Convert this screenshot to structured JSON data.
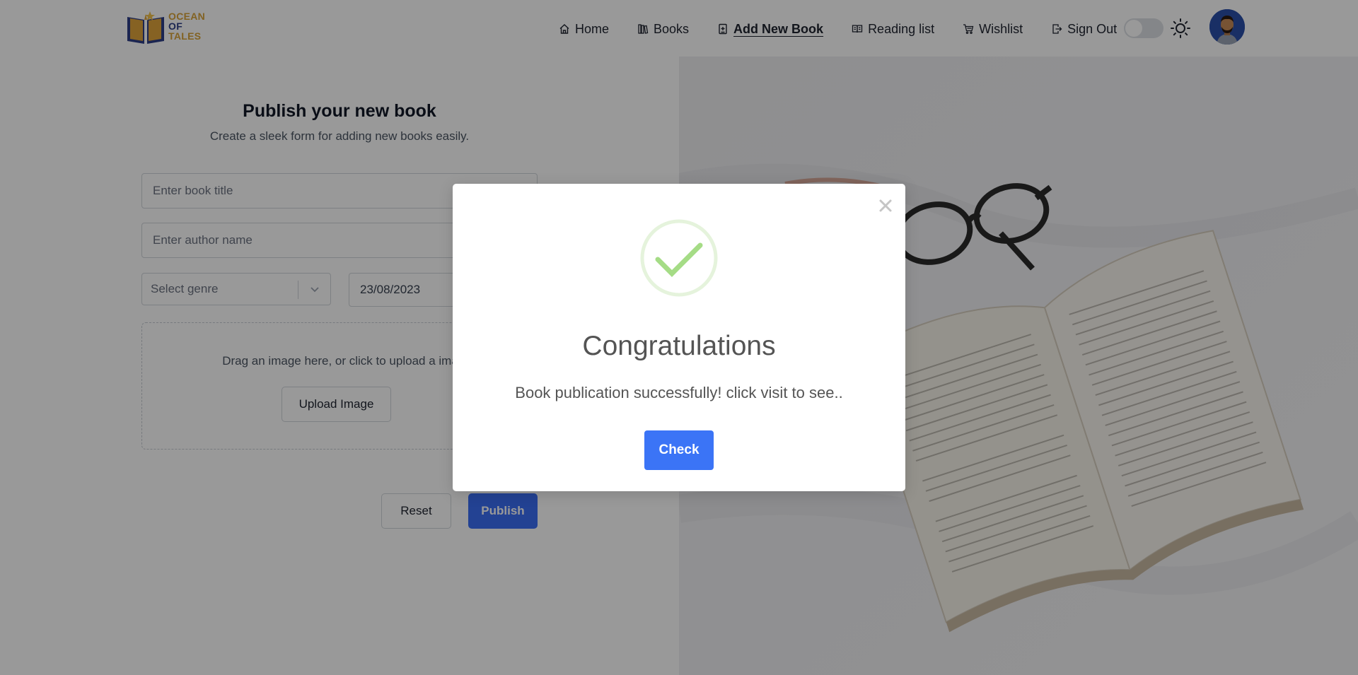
{
  "header": {
    "logo_lines": [
      "OCEAN",
      "OF",
      "TALES"
    ],
    "nav": [
      {
        "label": "Home",
        "icon": "home-icon"
      },
      {
        "label": "Books",
        "icon": "books-icon"
      },
      {
        "label": "Add New Book",
        "icon": "add-book-icon",
        "active": true
      },
      {
        "label": "Reading list",
        "icon": "open-book-icon"
      },
      {
        "label": "Wishlist",
        "icon": "cart-icon"
      },
      {
        "label": "Sign Out",
        "icon": "sign-out-icon"
      }
    ],
    "theme_toggle": "off",
    "theme_icon": "sun-icon"
  },
  "form": {
    "title": "Publish your new book",
    "subtitle": "Create a sleek form for adding new books easily.",
    "book_title_placeholder": "Enter book title",
    "author_placeholder": "Enter author name",
    "genre_placeholder": "Select genre",
    "date_value": "23/08/2023",
    "dropzone_text": "Drag an image here, or click to upload a ima",
    "upload_label": "Upload Image",
    "reset_label": "Reset",
    "publish_label": "Publish"
  },
  "modal": {
    "title": "Congratulations",
    "message": "Book publication successfully! click visit to see..",
    "button_label": "Check",
    "icon": "success-check-icon"
  },
  "colors": {
    "primary": "#3b74f6",
    "logo_gold": "#d9a43a",
    "logo_blue": "#2d3f87",
    "success_green": "#a5dc86"
  }
}
